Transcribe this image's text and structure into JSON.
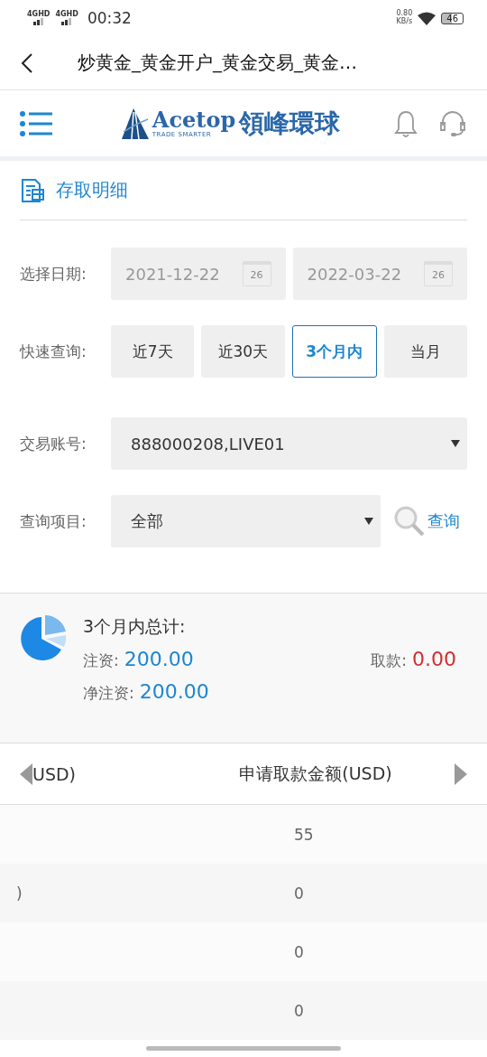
{
  "status_bar": {
    "signals": [
      "4GHD",
      "4GHD"
    ],
    "time": "00:32",
    "speed_value": "0.80",
    "speed_unit": "KB/s",
    "battery": "46"
  },
  "nav": {
    "title": "炒黄金_黄金开户_黄金交易_黄金…"
  },
  "header": {
    "brand": "Acetop",
    "tagline": "TRADE SMARTER",
    "brand_cn": "領峰環球"
  },
  "section": {
    "title": "存取明细"
  },
  "date_range": {
    "label": "选择日期:",
    "fields": [
      {
        "value": "2021-12-22",
        "disabled": true,
        "calendar_day": "26"
      },
      {
        "value": "2022-03-22",
        "disabled": true,
        "calendar_day": "26"
      }
    ]
  },
  "quick_query": {
    "label": "快速查询:",
    "options": [
      {
        "label": "近7天",
        "selected": false
      },
      {
        "label": "近30天",
        "selected": false
      },
      {
        "label": "3个月内",
        "selected": true
      },
      {
        "label": "当月",
        "selected": false
      }
    ]
  },
  "account": {
    "label": "交易账号:",
    "value": "888000208,LIVE01"
  },
  "query_item": {
    "label": "查询项目:",
    "value": "全部",
    "button": "查询"
  },
  "summary": {
    "title": "3个月内总计:",
    "deposit_label": "注资:",
    "deposit": "200.00",
    "withdraw_label": "取款:",
    "withdraw": "0.00",
    "net_label": "净注资:",
    "net": "200.00"
  },
  "table": {
    "columns": [
      "USD)",
      "申请取款金额(USD)"
    ],
    "rows": [
      {
        "amount": "55"
      },
      {
        "column_1": ")",
        "amount": "0"
      },
      {
        "amount": "0"
      },
      {
        "amount": "0"
      }
    ]
  }
}
